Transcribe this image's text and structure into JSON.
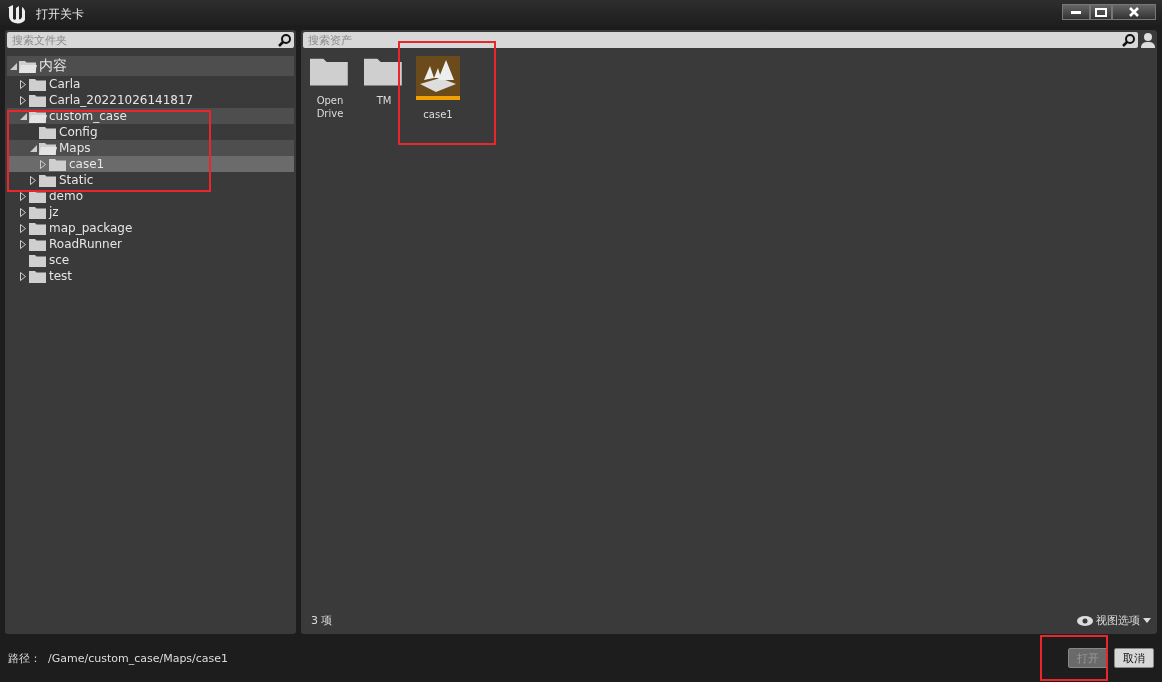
{
  "window": {
    "title": "打开关卡"
  },
  "folder_search": {
    "placeholder": "搜索文件夹"
  },
  "tree": [
    {
      "label": "内容",
      "expanded": true,
      "selected": false,
      "children": [
        {
          "label": "Carla",
          "expanded": false,
          "selected": false
        },
        {
          "label": "Carla_20221026141817",
          "expanded": false,
          "selected": false
        },
        {
          "label": "custom_case",
          "expanded": true,
          "selected": false,
          "children": [
            {
              "label": "Config",
              "selected": false
            },
            {
              "label": "Maps",
              "expanded": true,
              "selected": false,
              "children": [
                {
                  "label": "case1",
                  "expanded": false,
                  "selected": true
                }
              ]
            },
            {
              "label": "Static",
              "expanded": false,
              "selected": false
            }
          ]
        },
        {
          "label": "demo",
          "expanded": false,
          "selected": false
        },
        {
          "label": "jz",
          "expanded": false,
          "selected": false
        },
        {
          "label": "map_package",
          "expanded": false,
          "selected": false
        },
        {
          "label": "RoadRunner",
          "expanded": false,
          "selected": false
        },
        {
          "label": "sce",
          "selected": false
        },
        {
          "label": "test",
          "expanded": false,
          "selected": false
        }
      ]
    }
  ],
  "asset_search": {
    "placeholder": "搜索资产"
  },
  "assets": [
    {
      "kind": "folder",
      "label": "Open Drive"
    },
    {
      "kind": "folder",
      "label": "TM"
    },
    {
      "kind": "level",
      "label": "case1"
    }
  ],
  "item_count": "3 项",
  "view_options": "视图选项",
  "path": {
    "label": "路径：",
    "value": "/Game/custom_case/Maps/case1"
  },
  "buttons": [
    {
      "label": "打开",
      "disabled": true
    },
    {
      "label": "取消",
      "disabled": false
    }
  ]
}
